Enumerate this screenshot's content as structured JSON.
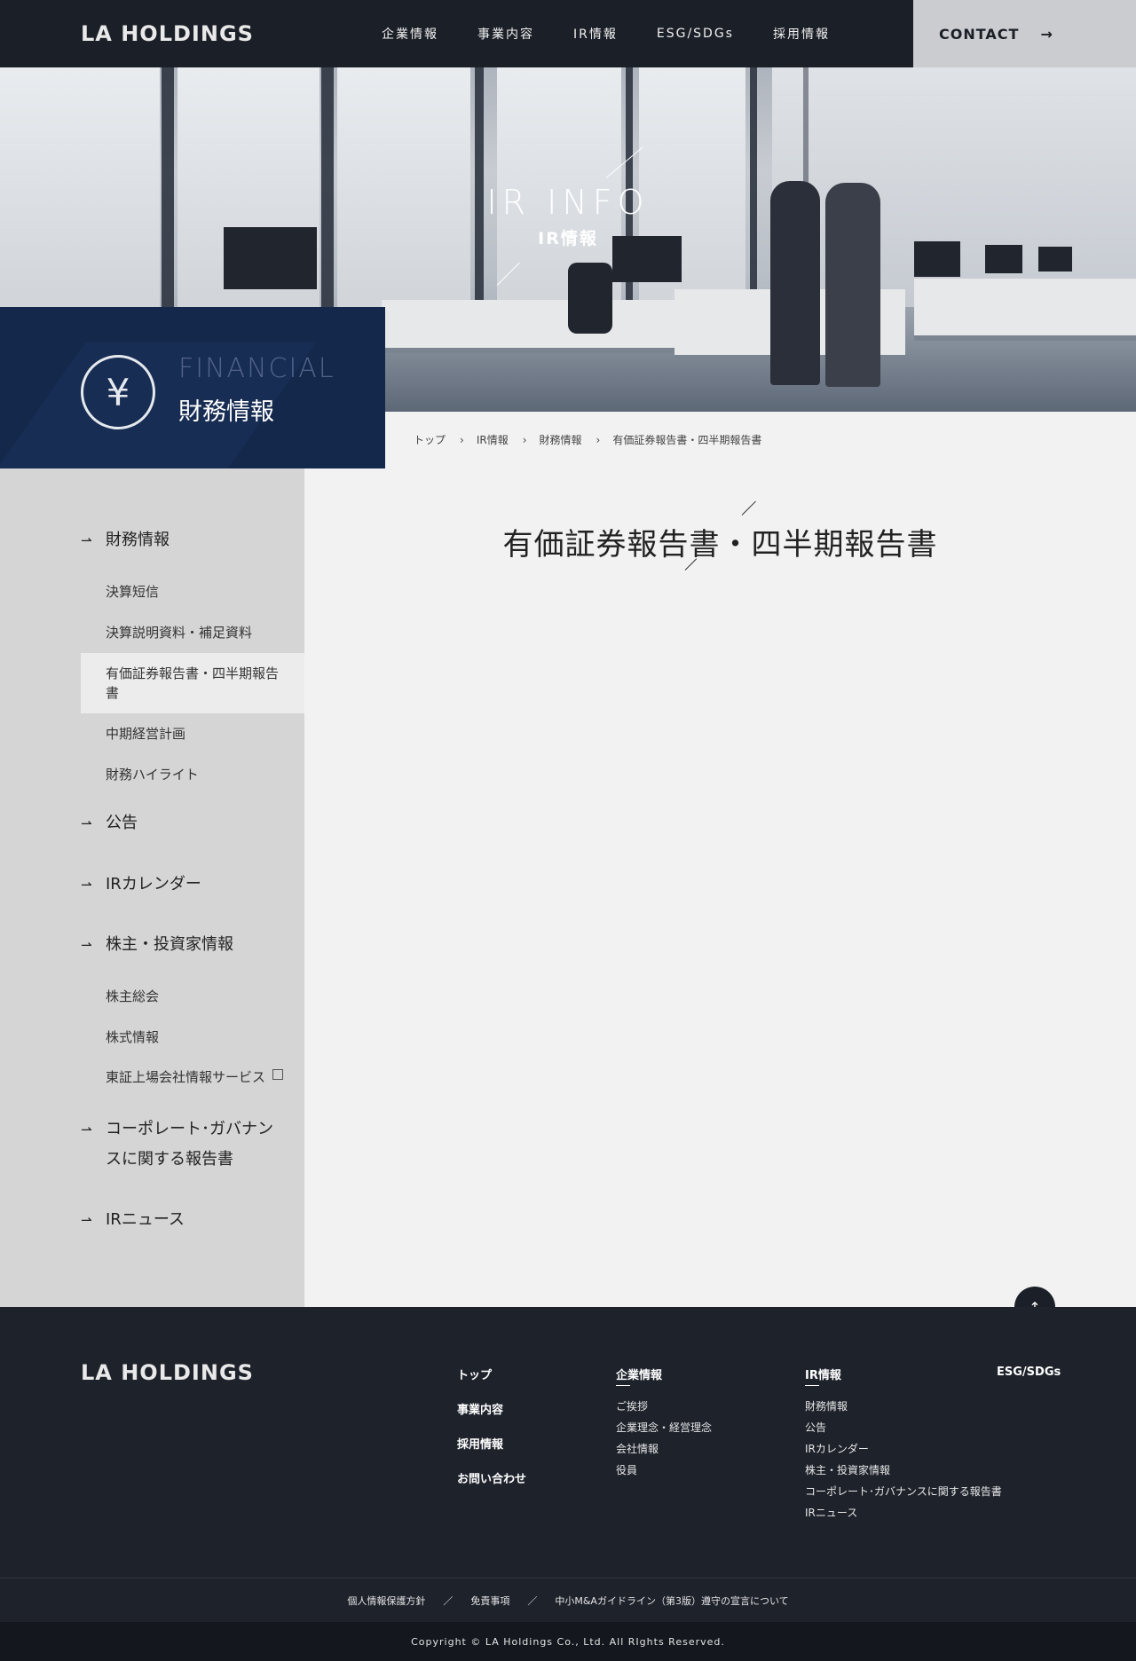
{
  "header": {
    "logo": "LA HOLDINGS",
    "nav": [
      "企業情報",
      "事業内容",
      "IR情報",
      "ESG/SDGs",
      "採用情報"
    ],
    "contact_label": "CONTACT",
    "contact_arrow": "→"
  },
  "hero": {
    "title_en": "IR INFO",
    "title_ja": "IR情報"
  },
  "category": {
    "icon": "¥",
    "title_en": "FINANCIAL",
    "title_ja": "財務情報"
  },
  "breadcrumb": {
    "items": [
      "トップ",
      "IR情報",
      "財務情報",
      "有価証券報告書・四半期報告書"
    ],
    "separator": "›"
  },
  "sidebar": {
    "arrow": "⇀",
    "groups": [
      {
        "label": "財務情報",
        "subs": [
          "決算短信",
          "決算説明資料・補足資料",
          "有価証券報告書・四半期報告書",
          "中期経営計画",
          "財務ハイライト"
        ]
      },
      {
        "label": "公告"
      },
      {
        "label": "IRカレンダー"
      },
      {
        "label": "株主・投資家情報",
        "subs": [
          "株主総会",
          "株式情報",
          "東証上場会社情報サービス"
        ]
      },
      {
        "label": "コーポレート･ガバナンスに関する報告書"
      },
      {
        "label": "IRニュース"
      }
    ]
  },
  "main": {
    "title": "有価証券報告書・四半期報告書"
  },
  "to_top": "↑",
  "footer": {
    "logo": "LA HOLDINGS",
    "col1": [
      "トップ",
      "事業内容",
      "採用情報",
      "お問い合わせ"
    ],
    "col2": {
      "head": "企業情報",
      "links": [
        "ご挨拶",
        "企業理念・経営理念",
        "会社情報",
        "役員"
      ]
    },
    "col3": {
      "head": "IR情報",
      "links": [
        "財務情報",
        "公告",
        "IRカレンダー",
        "株主・投資家情報",
        "コーポレート･ガバナンスに関する報告書",
        "IRニュース"
      ]
    },
    "col4": {
      "head": "ESG/SDGs"
    },
    "bottom_links": [
      "個人情報保護方針",
      "免責事項",
      "中小M&Aガイドライン（第3版）遵守の宣言について"
    ],
    "bottom_sep": "／",
    "copyright": "Copyright © LA Holdings Co., Ltd. All RIghts Reserved."
  }
}
